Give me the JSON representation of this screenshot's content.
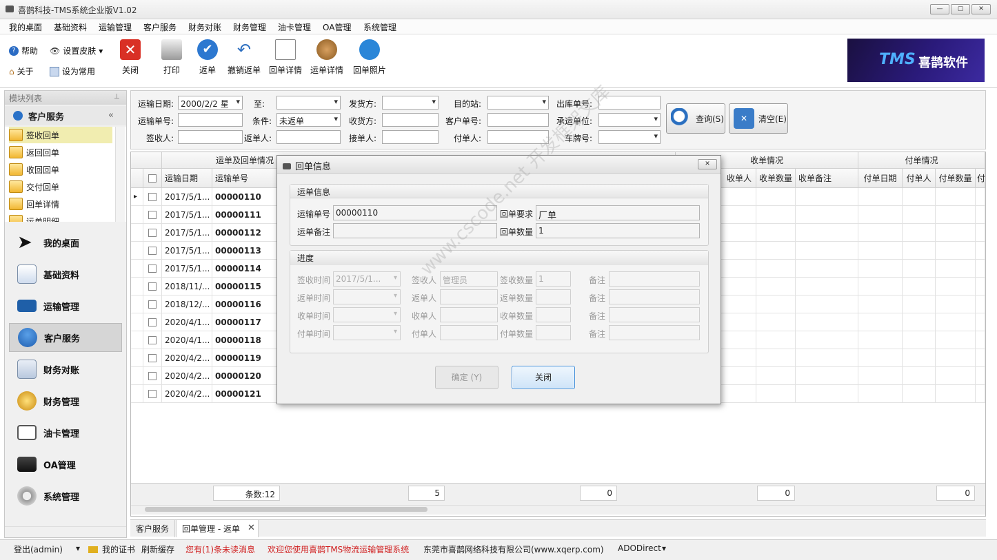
{
  "window": {
    "title": "喜鹊科技-TMS系统企业版V1.02"
  },
  "menu": [
    "我的桌面",
    "基础资料",
    "运输管理",
    "客户服务",
    "财务对账",
    "财务管理",
    "油卡管理",
    "OA管理",
    "系统管理"
  ],
  "toolbar": {
    "help": "帮助",
    "skin": "设置皮肤",
    "about": "关于",
    "set_common": "设为常用",
    "buttons": [
      "关闭",
      "打印",
      "返单",
      "撤销返单",
      "回单详情",
      "运单详情",
      "回单照片"
    ]
  },
  "logo": {
    "tms": "TMS",
    "name": "喜鹊软件"
  },
  "left_panel": {
    "header": "模块列表",
    "section": "客户服务",
    "sub_items": [
      "签收回单",
      "返回回单",
      "收回回单",
      "交付回单",
      "回单详情",
      "运单明细"
    ],
    "nav": [
      "我的桌面",
      "基础资料",
      "运输管理",
      "客户服务",
      "财务对账",
      "财务管理",
      "油卡管理",
      "OA管理",
      "系统管理"
    ]
  },
  "filters": {
    "transport_date_label": "运输日期:",
    "transport_date": "2000/2/2 星",
    "to_label": "至:",
    "shipper_label": "发货方:",
    "dest_label": "目的站:",
    "outbound_label": "出库单号:",
    "waybill_label": "运输单号:",
    "condition_label": "条件:",
    "condition": "未返单",
    "receiver_label": "收货方:",
    "customer_no_label": "客户单号:",
    "carrier_label": "承运单位:",
    "signer_label": "签收人:",
    "returner_label": "返单人:",
    "acceptor_label": "接单人:",
    "payer_label": "付单人:",
    "plate_label": "车牌号:",
    "query": "查询(S)",
    "clear": "清空(E)"
  },
  "grid": {
    "group_waybill": "运单及回单情况",
    "group_receive": "收单情况",
    "group_pay": "付单情况",
    "col_date": "运输日期",
    "col_no": "运输单号",
    "col_recv_person": "收单人",
    "col_recv_qty": "收单数量",
    "col_recv_note": "收单备注",
    "col_pay_date": "付单日期",
    "col_pay_person": "付单人",
    "col_pay_qty": "付单数量",
    "col_extra": "付",
    "rows": [
      {
        "date": "2017/5/1...",
        "no": "00000110"
      },
      {
        "date": "2017/5/1...",
        "no": "00000111"
      },
      {
        "date": "2017/5/1...",
        "no": "00000112"
      },
      {
        "date": "2017/5/1...",
        "no": "00000113"
      },
      {
        "date": "2017/5/1...",
        "no": "00000114"
      },
      {
        "date": "2018/11/...",
        "no": "00000115"
      },
      {
        "date": "2018/12/...",
        "no": "00000116"
      },
      {
        "date": "2020/4/1...",
        "no": "00000117"
      },
      {
        "date": "2020/4/1...",
        "no": "00000118"
      },
      {
        "date": "2020/4/2...",
        "no": "00000119"
      },
      {
        "date": "2020/4/2...",
        "no": "00000120"
      },
      {
        "date": "2020/4/2...",
        "no": "00000121"
      }
    ],
    "footer": {
      "count": "条数:12",
      "s1": "5",
      "s2": "0",
      "s3": "0",
      "s4": "0"
    }
  },
  "tabs": [
    "客户服务",
    "回单管理 - 返单"
  ],
  "status": {
    "logout": "登出(admin)",
    "cert": "我的证书",
    "refresh": "刷新缓存",
    "msg": "您有(1)条未读消息",
    "welcome": "欢迎您使用喜鹊TMS物流运输管理系统",
    "company": "东莞市喜鹊网络科技有限公司(www.xqerp.com)",
    "db": "ADODirect"
  },
  "dialog": {
    "title": "回单信息",
    "group1": "运单信息",
    "waybill_label": "运输单号",
    "waybill": "00000110",
    "require_label": "回单要求",
    "require": "厂单",
    "note_label": "运单备注",
    "qty_label": "回单数量",
    "qty": "1",
    "group2": "进度",
    "sign_time": "签收时间",
    "sign_time_val": "2017/5/1...",
    "signer": "签收人",
    "signer_val": "管理员",
    "sign_qty": "签收数量",
    "sign_qty_val": "1",
    "note": "备注",
    "return_time": "返单时间",
    "returner": "返单人",
    "return_qty": "返单数量",
    "recv_time": "收单时间",
    "recv_person": "收单人",
    "recv_qty": "收单数量",
    "pay_time": "付单时间",
    "pay_person": "付单人",
    "pay_qty": "付单数量",
    "ok": "确定 (Y)",
    "close": "关闭"
  },
  "watermark": "www.cscode.net 开发框架文库"
}
